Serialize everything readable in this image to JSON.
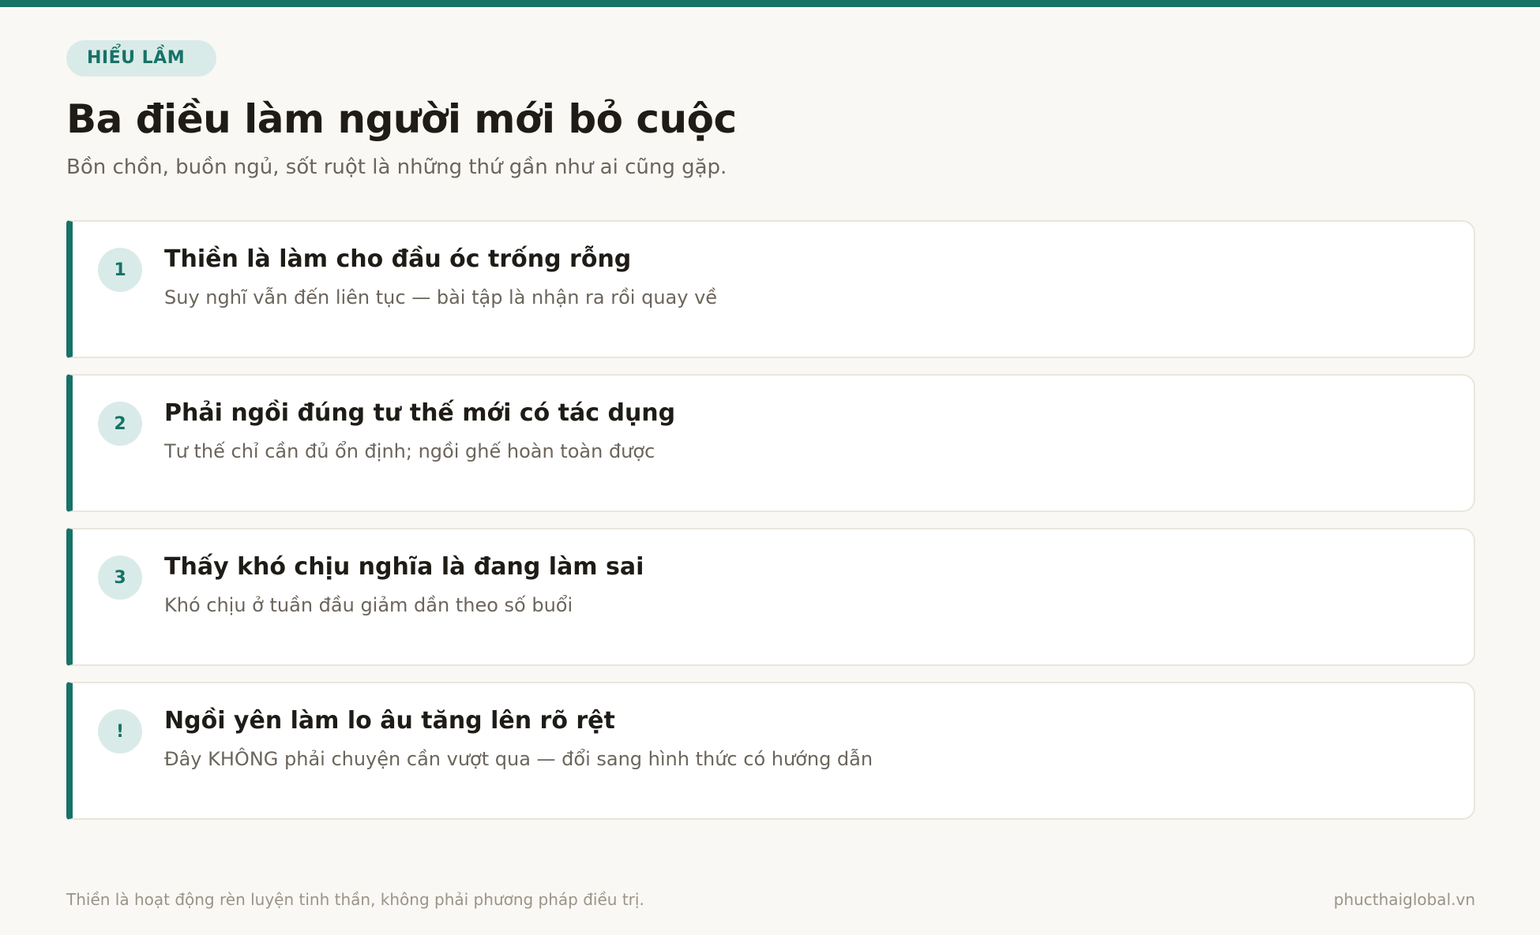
{
  "header": {
    "tag": "HIỂU LẦM",
    "title": "Ba điều làm người mới bỏ cuộc",
    "subtitle": "Bồn chồn, buồn ngủ, sốt ruột là những thứ gần như ai cũng gặp."
  },
  "cards": [
    {
      "badge": "1",
      "title": "Thiền là làm cho đầu óc trống rỗng",
      "description": "Suy nghĩ vẫn đến liên tục — bài tập là nhận ra rồi quay về"
    },
    {
      "badge": "2",
      "title": "Phải ngồi đúng tư thế mới có tác dụng",
      "description": "Tư thế chỉ cần đủ ổn định; ngồi ghế hoàn toàn được"
    },
    {
      "badge": "3",
      "title": "Thấy khó chịu nghĩa là đang làm sai",
      "description": "Khó chịu ở tuần đầu giảm dần theo số buổi"
    },
    {
      "badge": "!",
      "title": "Ngồi yên làm lo âu tăng lên rõ rệt",
      "description": "Đây KHÔNG phải chuyện cần vượt qua — đổi sang hình thức có hướng dẫn"
    }
  ],
  "footer": {
    "disclaimer": "Thiền là hoạt động rèn luyện tinh thần, không phải phương pháp điều trị.",
    "site": "phucthaiglobal.vn"
  },
  "colors": {
    "accent": "#177267",
    "accent_soft": "#d9ebe8",
    "background": "#faf8f4",
    "card_border": "#ebe6dc",
    "text_primary": "#1f1c17",
    "text_secondary": "#6b655c",
    "text_muted": "#9a9388"
  }
}
